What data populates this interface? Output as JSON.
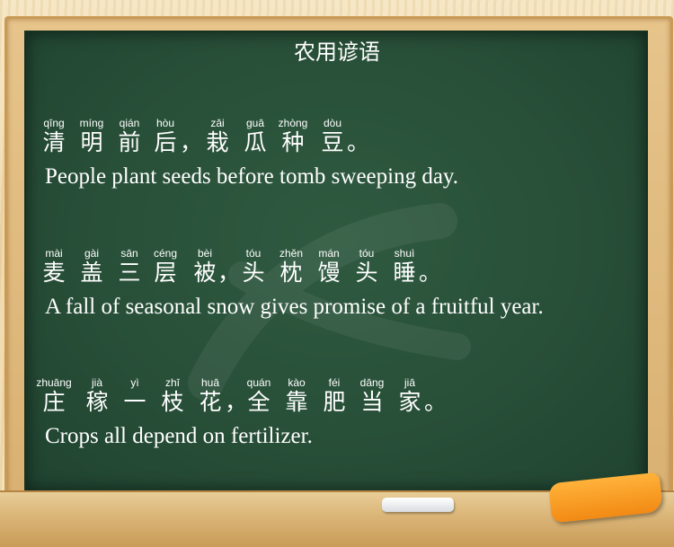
{
  "title": "农用谚语",
  "proverbs": [
    {
      "chars": [
        {
          "py": "qīng",
          "hz": "清"
        },
        {
          "py": "míng",
          "hz": "明"
        },
        {
          "py": "qián",
          "hz": "前"
        },
        {
          "py": "hòu",
          "hz": "后"
        },
        {
          "py": "zāi",
          "hz": "栽"
        },
        {
          "py": "guā",
          "hz": "瓜"
        },
        {
          "py": "zhòng",
          "hz": "种"
        },
        {
          "py": "dòu",
          "hz": "豆"
        }
      ],
      "comma": "，",
      "period": "。",
      "english": "People plant seeds before tomb sweeping day."
    },
    {
      "chars": [
        {
          "py": "mài",
          "hz": "麦"
        },
        {
          "py": "gài",
          "hz": "盖"
        },
        {
          "py": "sān",
          "hz": "三"
        },
        {
          "py": "céng",
          "hz": "层"
        },
        {
          "py": "bèi",
          "hz": "被"
        },
        {
          "py": "tóu",
          "hz": "头"
        },
        {
          "py": "zhěn",
          "hz": "枕"
        },
        {
          "py": "mán",
          "hz": "馒"
        },
        {
          "py": "tóu",
          "hz": "头"
        },
        {
          "py": "shuì",
          "hz": "睡"
        }
      ],
      "comma": "，",
      "period": "。",
      "english": "A fall of seasonal snow gives promise of a fruitful year."
    },
    {
      "chars": [
        {
          "py": "zhuāng",
          "hz": "庄"
        },
        {
          "py": "jià",
          "hz": "稼"
        },
        {
          "py": "yì",
          "hz": "一"
        },
        {
          "py": "zhī",
          "hz": "枝"
        },
        {
          "py": "huā",
          "hz": "花"
        },
        {
          "py": "quán",
          "hz": "全"
        },
        {
          "py": "kào",
          "hz": "靠"
        },
        {
          "py": "féi",
          "hz": "肥"
        },
        {
          "py": "dāng",
          "hz": "当"
        },
        {
          "py": "jiā",
          "hz": "家"
        }
      ],
      "comma": "，",
      "period": "。",
      "english": "Crops all depend on fertilizer."
    }
  ]
}
